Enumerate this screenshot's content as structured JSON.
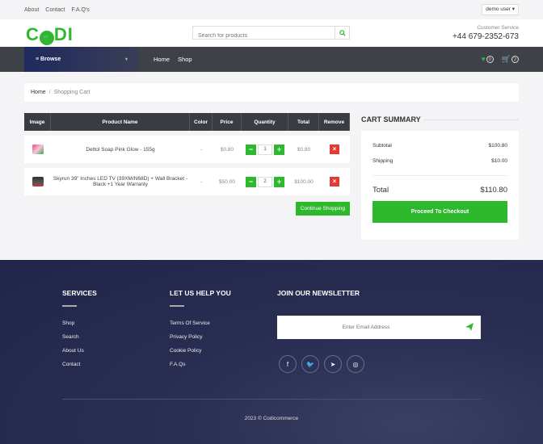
{
  "topbar": {
    "links": [
      "About",
      "Contact",
      "F.A.Q's"
    ],
    "user": "demo user ▾"
  },
  "header": {
    "logo": "C DI",
    "logo_left": "C",
    "logo_right": "DI",
    "search_placeholder": "Search for products",
    "cs_label": "Customer Service",
    "cs_phone": "+44 679-2352-673"
  },
  "nav": {
    "browse": "≡ Browse",
    "links": [
      "Home",
      "Shop"
    ],
    "wish_count": "0",
    "cart_count": "2"
  },
  "breadcrumb": {
    "home": "Home",
    "current": "Shopping Cart"
  },
  "cart": {
    "headers": [
      "Image",
      "Product Name",
      "Color",
      "Price",
      "Quantity",
      "Total",
      "Remove"
    ],
    "rows": [
      {
        "name": "Dettol Soap Pink Glow - 155g",
        "color": "-",
        "price": "$0.80",
        "qty": "1",
        "total": "$0.80"
      },
      {
        "name": "Skyrun 39\" Inches LED TV (39XM/N68D) + Wall Bracket - Black +1 Year Warranty",
        "color": "-",
        "price": "$50.00",
        "qty": "2",
        "total": "$100.00"
      }
    ],
    "continue": "Continue Shopping"
  },
  "summary": {
    "title": "CART SUMMARY",
    "subtotal_label": "Subtotal",
    "subtotal": "$100.80",
    "shipping_label": "Shipping",
    "shipping": "$10.00",
    "total_label": "Total",
    "total": "$110.80",
    "checkout": "Proceed To Checkout"
  },
  "footer": {
    "services_title": "SERVICES",
    "services": [
      "Shop",
      "Search",
      "About Us",
      "Contact"
    ],
    "help_title": "LET US HELP YOU",
    "help": [
      "Terms Of Service",
      "Privacy Policy",
      "Cookie Policy",
      "F.A.Qs"
    ],
    "newsletter_title": "JOIN OUR NEWSLETTER",
    "email_placeholder": "Enter Email Address",
    "copyright": "2023 © Codicommerce"
  },
  "colors": {
    "accent": "#2eb82e",
    "nav": "#3f4149",
    "danger": "#e53935",
    "footer": "#2a2e52"
  }
}
